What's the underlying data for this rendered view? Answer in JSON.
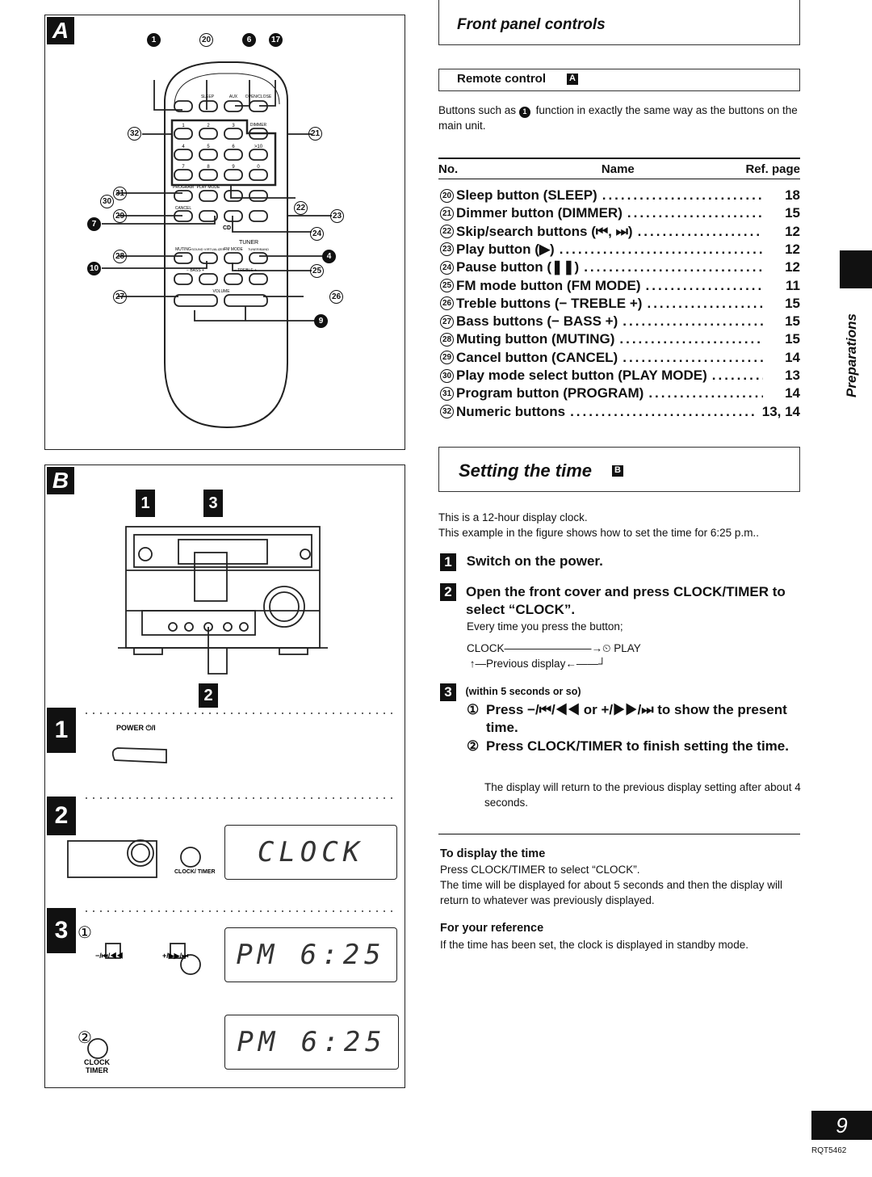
{
  "header": {
    "title": "Front panel controls"
  },
  "remote_section": {
    "title": "Remote control",
    "badge": "A",
    "intro_pre": "Buttons such as",
    "intro_ref": "1",
    "intro_post": "function in exactly the same way as the buttons on the main unit."
  },
  "table": {
    "headers": {
      "no": "No.",
      "name": "Name",
      "ref": "Ref. page"
    },
    "rows": [
      {
        "no": "20",
        "name": "Sleep button (SLEEP)",
        "ref": "18"
      },
      {
        "no": "21",
        "name": "Dimmer button (DIMMER)",
        "ref": "15"
      },
      {
        "no": "22",
        "name": "Skip/search buttons (⏮, ⏭)",
        "ref": "12"
      },
      {
        "no": "23",
        "name": "Play button (▶)",
        "ref": "12"
      },
      {
        "no": "24",
        "name": "Pause button (❚❚)",
        "ref": "12"
      },
      {
        "no": "25",
        "name": "FM mode button (FM MODE)",
        "ref": "11"
      },
      {
        "no": "26",
        "name": "Treble buttons (− TREBLE +)",
        "ref": "15"
      },
      {
        "no": "27",
        "name": "Bass buttons (− BASS +)",
        "ref": "15"
      },
      {
        "no": "28",
        "name": "Muting button (MUTING)",
        "ref": "15"
      },
      {
        "no": "29",
        "name": "Cancel button (CANCEL)",
        "ref": "14"
      },
      {
        "no": "30",
        "name": "Play mode select button (PLAY MODE)",
        "ref": "13"
      },
      {
        "no": "31",
        "name": "Program button (PROGRAM)",
        "ref": "14"
      },
      {
        "no": "32",
        "name": "Numeric buttons",
        "ref": "13, 14"
      }
    ]
  },
  "time_section": {
    "title": "Setting the time",
    "badge": "B",
    "intro1": "This is a 12-hour display clock.",
    "intro2": "This example in the figure shows how to set the time for 6:25 p.m..",
    "step1": {
      "num": "1",
      "text": "Switch on the power."
    },
    "step2": {
      "num": "2",
      "text": "Open the front cover and press CLOCK/TIMER to select “CLOCK”.",
      "note": "Every time you press the button;",
      "flow_a": "CLOCK",
      "flow_b": "⏲ PLAY",
      "flow_c": "Previous display"
    },
    "step3": {
      "num": "3",
      "cond": "(within 5 seconds or so)",
      "sub1_n": "①",
      "sub1": "Press −/⏮/◀◀ or +/▶▶/⏭ to show the present time.",
      "sub2_n": "②",
      "sub2": "Press CLOCK/TIMER to finish setting the time.",
      "note": "The display will return to the previous display setting after about 4 seconds."
    }
  },
  "display_time": {
    "title": "To display the time",
    "line1": "Press CLOCK/TIMER to select “CLOCK”.",
    "line2": "The time will be displayed for about 5 seconds and then the display will return to whatever was previously displayed."
  },
  "reference": {
    "title": "For your reference",
    "text": "If the time has been set, the clock is displayed in standby mode."
  },
  "side_tab": {
    "label": "Preparations"
  },
  "footer": {
    "page_number": "9",
    "code": "RQT5462"
  },
  "figure_a": {
    "badge": "A",
    "callouts": {
      "c1": "1",
      "c20": "20",
      "c6": "6",
      "c17": "17",
      "c32": "32",
      "c21": "21",
      "c31": "31",
      "c30": "30",
      "c22": "22",
      "c29": "29",
      "c23": "23",
      "c7": "7",
      "c24": "24",
      "c28": "28",
      "c4": "4",
      "c10": "10",
      "c25": "25",
      "c27": "27",
      "c26": "26",
      "c9": "9"
    },
    "labels": {
      "sleep": "SLEEP",
      "aux": "AUX",
      "open_close": "OPEN/CLOSE",
      "dimmer": "DIMMER",
      "program": "PROGRAM",
      "play_mode": "PLAY MODE",
      "cancel": "CANCEL",
      "cd": "CD",
      "tuner": "TUNER",
      "muting": "MUTING",
      "sound_virt": "SOUND VIRTUALIZER",
      "fm_mode": "FM MODE",
      "tuner_band": "TUNER/BAND",
      "bass": "− BASS +",
      "treble": "− TREBLE +",
      "volume": "VOLUME"
    },
    "numbers": [
      "1",
      "2",
      "3",
      "4",
      "5",
      "6",
      ">10",
      "7",
      "8",
      "9",
      "0"
    ]
  },
  "figure_b": {
    "badge": "B",
    "step_badges": [
      "1",
      "3",
      "2"
    ],
    "power_label": "POWER ⏻/I",
    "clock_timer_label": "CLOCK/ TIMER",
    "lcd_clock": "CLOCK",
    "lcd_time1": "PM  6:25",
    "lcd_time2": "PM  6:25",
    "sub1": "①",
    "sub2": "②",
    "minus_label": "−/⏮/◀◀",
    "plus_label": "+/▶▶/⏭",
    "clock_label": "CLOCK",
    "timer_label": "TIMER"
  }
}
